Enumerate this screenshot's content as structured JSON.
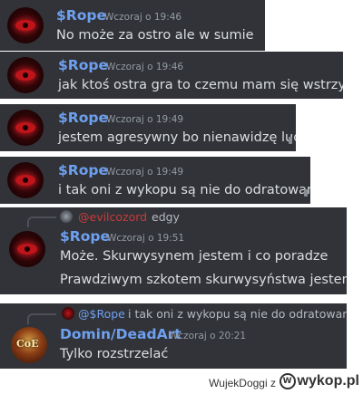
{
  "messages": [
    {
      "username": "$Rope",
      "timestamp": "Wczoraj o 19:46",
      "text": "No może za ostro ale w sumie"
    },
    {
      "username": "$Rope",
      "timestamp": "Wczoraj o 19:46",
      "text": "jak ktoś ostra gra to czemu mam się wstrzymać"
    },
    {
      "username": "$Rope",
      "timestamp": "Wczoraj o 19:49",
      "text": "jestem agresywny bo nienawidzę ludzi"
    },
    {
      "username": "$Rope",
      "timestamp": "Wczoraj o 19:49",
      "text": "i tak oni z wykopu są nie do odratowania"
    },
    {
      "reply": {
        "username": "@evilcozord",
        "text": "edgy"
      },
      "username": "$Rope",
      "timestamp": "Wczoraj o 19:51",
      "text": "Może. Skurwysynem jestem i co poradze",
      "text2": "Prawdziwym szkotem skurwysyństwa jestem"
    },
    {
      "reply": {
        "username": "@$Rope",
        "text": "i tak oni z wykopu są nie do odratowania"
      },
      "username": "Domin/DeadArt",
      "timestamp": "Wczoraj o 20:21",
      "text": "Tylko rozstrzelać"
    }
  ],
  "colors": {
    "background": "#313338",
    "username_rope": "#6ea0f0",
    "username_domin": "#6ea0f0",
    "reply_evil": "#c93a3a",
    "reply_rope": "#6ea0f0",
    "text": "#dbdee1",
    "timestamp": "#949ba4"
  },
  "footer": {
    "author": "WujekDoggi",
    "sep": "z",
    "brand": "wykop.pl",
    "brand_icon": "wykop-logo-icon"
  }
}
